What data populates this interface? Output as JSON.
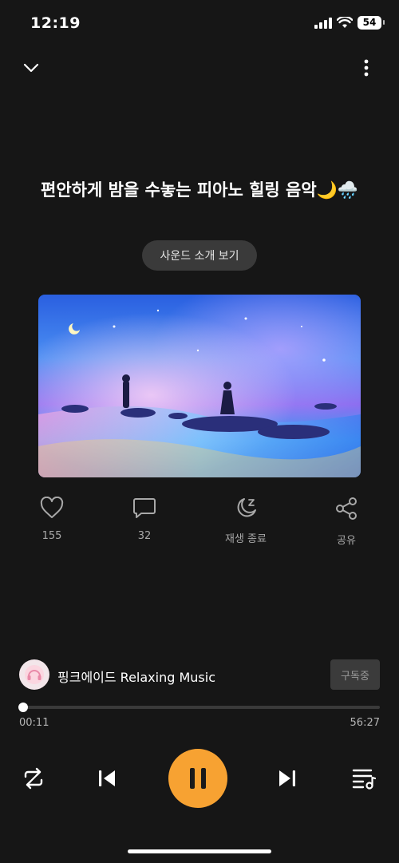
{
  "status_bar": {
    "time": "12:19",
    "battery": "54"
  },
  "title": "편안하게 밤을 수놓는 피아노 힐링 음악🌙🌧️",
  "sound_intro_label": "사운드 소개 보기",
  "actions": {
    "like_count": "155",
    "comment_count": "32",
    "sleep_timer_label": "재생 종료",
    "share_label": "공유"
  },
  "channel": {
    "name": "핑크에이드 Relaxing Music",
    "subscribe_label": "구독중"
  },
  "playback": {
    "current_time": "00:11",
    "total_time": "56:27",
    "progress": 0.003
  },
  "icons": {
    "back": "chevron-down-icon",
    "more": "more-vertical-icon",
    "like": "heart-icon",
    "comment": "comment-icon",
    "sleep": "moon-z-icon",
    "share": "share-icon",
    "repeat": "repeat-icon",
    "prev": "skip-previous-icon",
    "pause": "pause-icon",
    "next": "skip-next-icon",
    "playlist": "playlist-icon"
  },
  "colors": {
    "accent": "#f7a232",
    "background": "#161616"
  }
}
